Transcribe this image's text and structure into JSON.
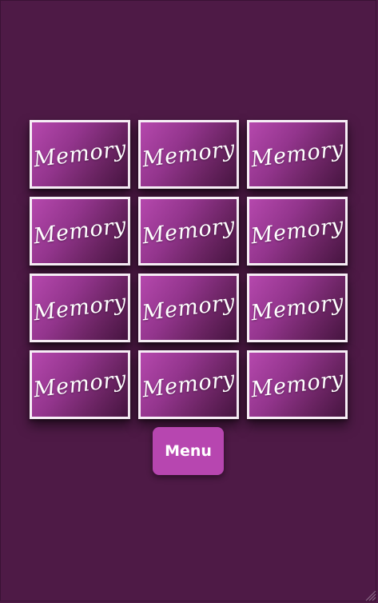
{
  "game": {
    "cards": [
      {
        "label": "Memory"
      },
      {
        "label": "Memory"
      },
      {
        "label": "Memory"
      },
      {
        "label": "Memory"
      },
      {
        "label": "Memory"
      },
      {
        "label": "Memory"
      },
      {
        "label": "Memory"
      },
      {
        "label": "Memory"
      },
      {
        "label": "Memory"
      },
      {
        "label": "Memory"
      },
      {
        "label": "Memory"
      },
      {
        "label": "Memory"
      }
    ],
    "menu_label": "Menu"
  },
  "colors": {
    "background": "#4e1a46",
    "card_border": "#f7eef6",
    "card_gradient_light": "#b548ad",
    "card_gradient_dark": "#461540",
    "menu_button": "#b746b0"
  },
  "icons": {
    "resize_grip": "resize-grip-icon"
  }
}
